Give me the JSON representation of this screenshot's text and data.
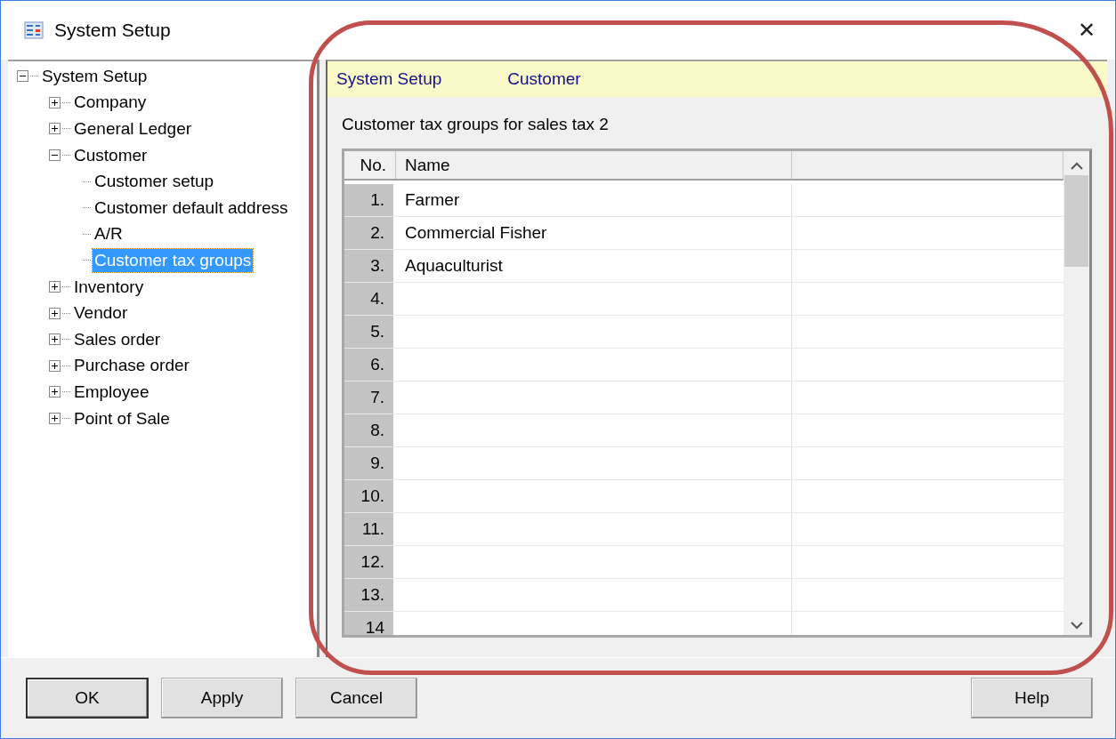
{
  "window": {
    "title": "System Setup",
    "close": "✕"
  },
  "tree": [
    {
      "label": "System Setup",
      "expanded": true,
      "selected": false,
      "children": [
        {
          "label": "Company",
          "expanded": false,
          "selected": false
        },
        {
          "label": "General Ledger",
          "expanded": false,
          "selected": false
        },
        {
          "label": "Customer",
          "expanded": true,
          "selected": false,
          "children": [
            {
              "label": "Customer setup",
              "selected": false
            },
            {
              "label": "Customer default address",
              "selected": false
            },
            {
              "label": "A/R",
              "selected": false
            },
            {
              "label": "Customer tax groups",
              "selected": true
            }
          ]
        },
        {
          "label": "Inventory",
          "expanded": false,
          "selected": false
        },
        {
          "label": "Vendor",
          "expanded": false,
          "selected": false
        },
        {
          "label": "Sales order",
          "expanded": false,
          "selected": false
        },
        {
          "label": "Purchase order",
          "expanded": false,
          "selected": false
        },
        {
          "label": "Employee",
          "expanded": false,
          "selected": false
        },
        {
          "label": "Point of Sale",
          "expanded": false,
          "selected": false
        }
      ]
    }
  ],
  "breadcrumb": [
    "System Setup",
    "Customer"
  ],
  "section_label": "Customer tax groups for sales tax 2",
  "grid": {
    "columns": [
      "No.",
      "Name"
    ],
    "rows": [
      {
        "no": "1.",
        "name": "Farmer"
      },
      {
        "no": "2.",
        "name": "Commercial Fisher"
      },
      {
        "no": "3.",
        "name": "Aquaculturist"
      },
      {
        "no": "4."
      },
      {
        "no": "5."
      },
      {
        "no": "6."
      },
      {
        "no": "7."
      },
      {
        "no": "8."
      },
      {
        "no": "9."
      },
      {
        "no": "10."
      },
      {
        "no": "11."
      },
      {
        "no": "12."
      },
      {
        "no": "13."
      },
      {
        "no": "14"
      }
    ]
  },
  "buttons_left": [
    "OK",
    "Apply",
    "Cancel"
  ],
  "buttons_right": [
    "Help"
  ],
  "annotation": {
    "kind": "outline"
  }
}
